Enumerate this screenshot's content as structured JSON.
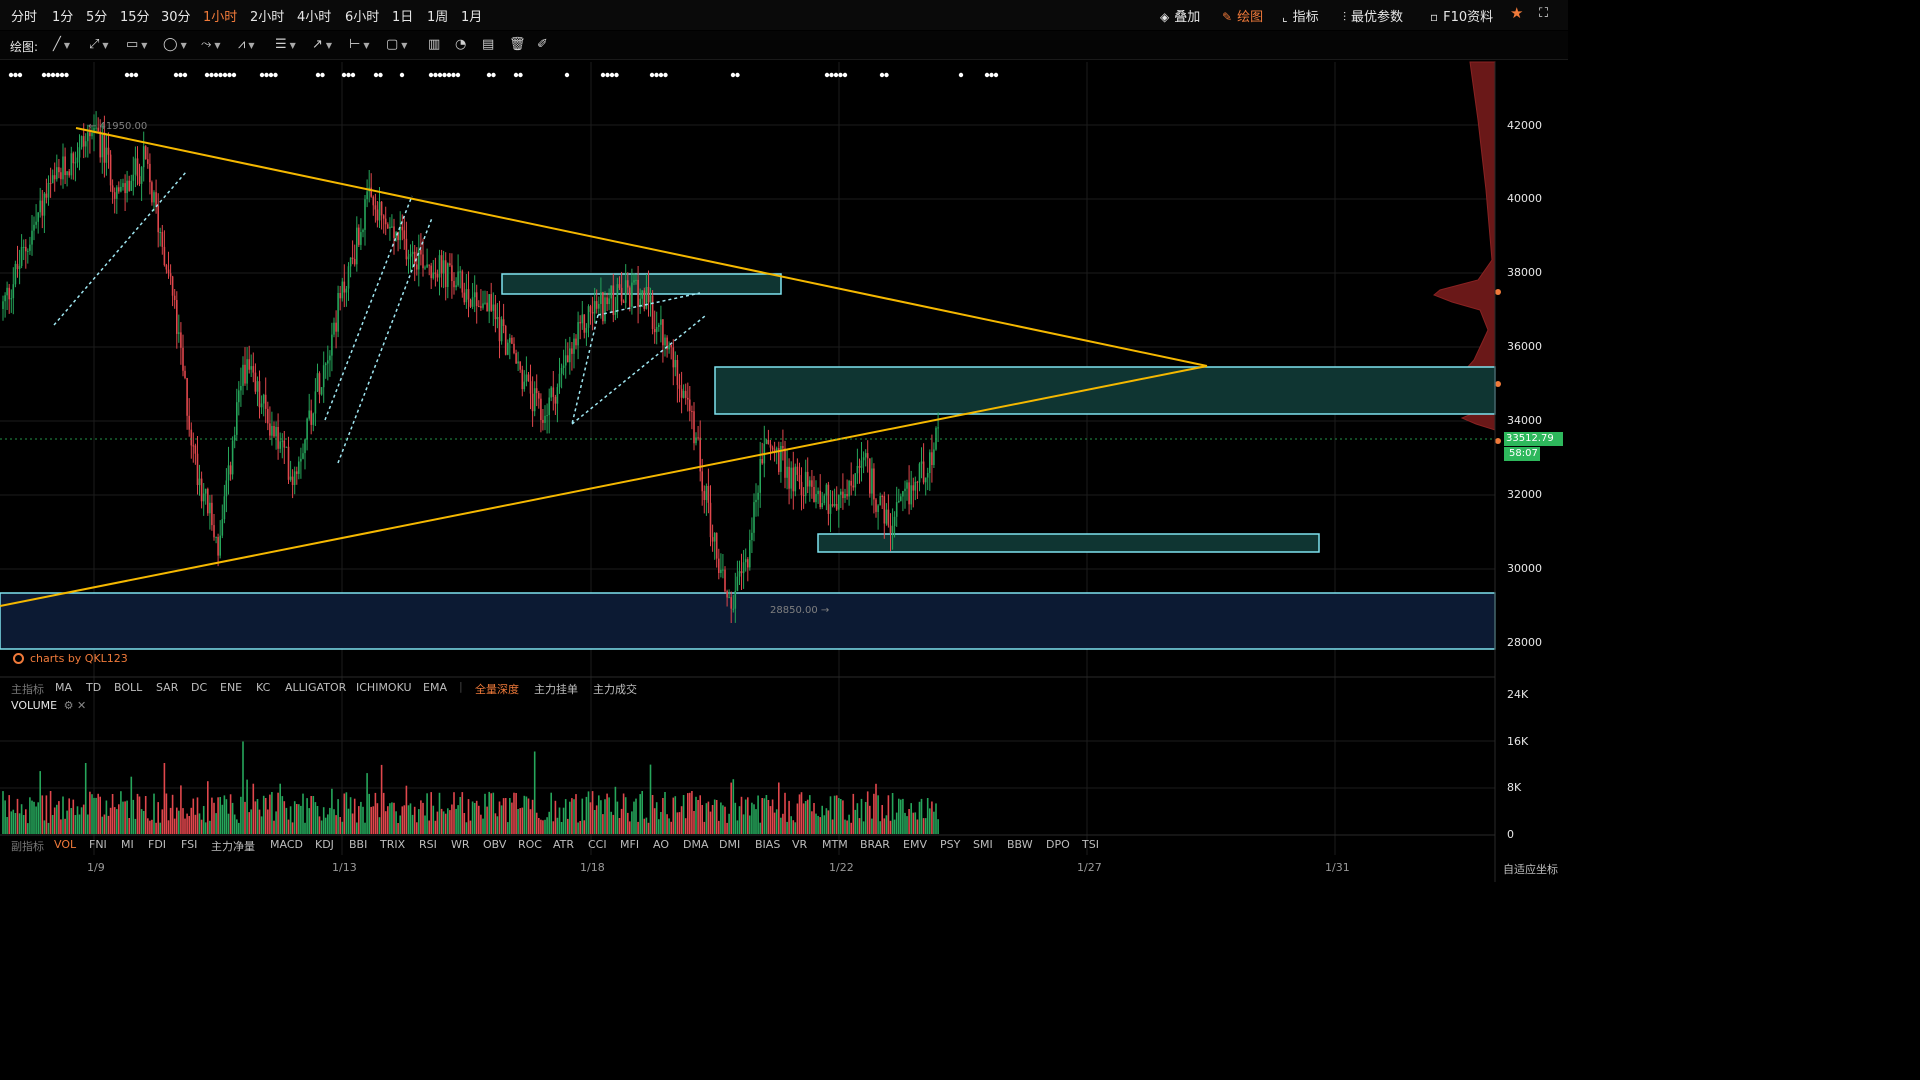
{
  "toolbar": {
    "timeframes": [
      "分时",
      "1分",
      "5分",
      "15分",
      "30分",
      "1小时",
      "2小时",
      "4小时",
      "6小时",
      "1日",
      "1周",
      "1月"
    ],
    "active_timeframe": "1小时",
    "right_tools": {
      "overlay": "叠加",
      "draw": "绘图",
      "indicator": "指标",
      "best_params": "最优参数",
      "f10": "F10资料"
    }
  },
  "draw_toolbar": {
    "label": "绘图:"
  },
  "chart": {
    "high_label": "← 41950.00",
    "low_label": "28850.00 →",
    "current_price": "33512.79",
    "countdown": "58:07",
    "watermark": "charts by QKL123",
    "y_ticks": [
      "42000",
      "40000",
      "38000",
      "36000",
      "34000",
      "32000",
      "30000",
      "28000"
    ],
    "vol_ticks": [
      "24K",
      "16K",
      "8K",
      "0"
    ],
    "x_ticks": [
      "1/9",
      "1/13",
      "1/18",
      "1/22",
      "1/27",
      "1/31"
    ],
    "auto_coord": "自适应坐标",
    "volume_label": "VOLUME"
  },
  "main_indicators": {
    "label": "主指标",
    "items": [
      "MA",
      "TD",
      "BOLL",
      "SAR",
      "DC",
      "ENE",
      "KC",
      "ALLIGATOR",
      "ICHIMOKU",
      "EMA"
    ],
    "extras": [
      "全量深度",
      "主力挂单",
      "主力成交"
    ],
    "active": "全量深度"
  },
  "sub_indicators": {
    "label": "副指标",
    "items": [
      "VOL",
      "FNI",
      "MI",
      "FDI",
      "FSI",
      "主力净量",
      "MACD",
      "KDJ",
      "BBI",
      "TRIX",
      "RSI",
      "WR",
      "OBV",
      "ROC",
      "ATR",
      "CCI",
      "MFI",
      "AO",
      "DMA",
      "DMI",
      "BIAS",
      "VR",
      "MTM",
      "BRAR",
      "EMV",
      "PSY",
      "SMI",
      "BBW",
      "DPO",
      "TSI"
    ],
    "active": "VOL"
  },
  "colors": {
    "up": "#26a65b",
    "down": "#e0474c",
    "trend": "#f5b800",
    "zone_border": "#7fe3f0",
    "accent": "#f07a3a",
    "price_tag": "#2eb85c"
  },
  "chart_data": {
    "type": "candlestick",
    "interval": "1 hour",
    "x_range": [
      "1/8",
      "2/2"
    ],
    "ylim": [
      27000,
      43500
    ],
    "vol_ylim": [
      0,
      26000
    ],
    "high": 41950,
    "low": 28850,
    "last": 33512.79,
    "path_points": [
      [
        "1/8",
        37000
      ],
      [
        "1/8",
        40000
      ],
      [
        "1/9",
        41950
      ],
      [
        "1/10",
        40000
      ],
      [
        "1/10",
        41000
      ],
      [
        "1/11",
        38000
      ],
      [
        "1/11",
        33000
      ],
      [
        "1/12",
        30500
      ],
      [
        "1/12",
        35500
      ],
      [
        "1/13",
        32500
      ],
      [
        "1/14",
        37500
      ],
      [
        "1/15",
        39900
      ],
      [
        "1/15",
        39000
      ],
      [
        "1/16",
        38000
      ],
      [
        "1/17",
        37000
      ],
      [
        "1/18",
        34000
      ],
      [
        "1/19",
        35500
      ],
      [
        "1/19",
        37000
      ],
      [
        "1/20",
        37500
      ],
      [
        "1/21",
        36000
      ],
      [
        "1/21",
        35000
      ],
      [
        "1/21",
        33000
      ],
      [
        "1/22",
        30500
      ],
      [
        "1/22",
        28850
      ],
      [
        "1/22",
        30500
      ],
      [
        "1/23",
        33500
      ],
      [
        "1/23",
        32500
      ],
      [
        "1/24",
        31700
      ],
      [
        "1/25",
        32800
      ],
      [
        "1/25",
        31000
      ],
      [
        "1/26",
        33500
      ]
    ],
    "annotations": {
      "trendlines": [
        {
          "from": [
            "1/9",
            41950
          ],
          "to": [
            "1/28",
            35500
          ]
        },
        {
          "from": [
            "1/8",
            28100
          ],
          "to": [
            "1/28",
            35500
          ]
        }
      ],
      "zones": [
        {
          "from": "1/17",
          "to": "1/21",
          "low": 37200,
          "high": 38000
        },
        {
          "from": "1/21",
          "to": "2/2",
          "low": 34200,
          "high": 35500
        },
        {
          "from": "1/22",
          "to": "1/27",
          "low": 30400,
          "high": 30900
        },
        {
          "from": "1/8",
          "to": "2/2",
          "low": 27800,
          "high": 29300
        }
      ]
    }
  }
}
